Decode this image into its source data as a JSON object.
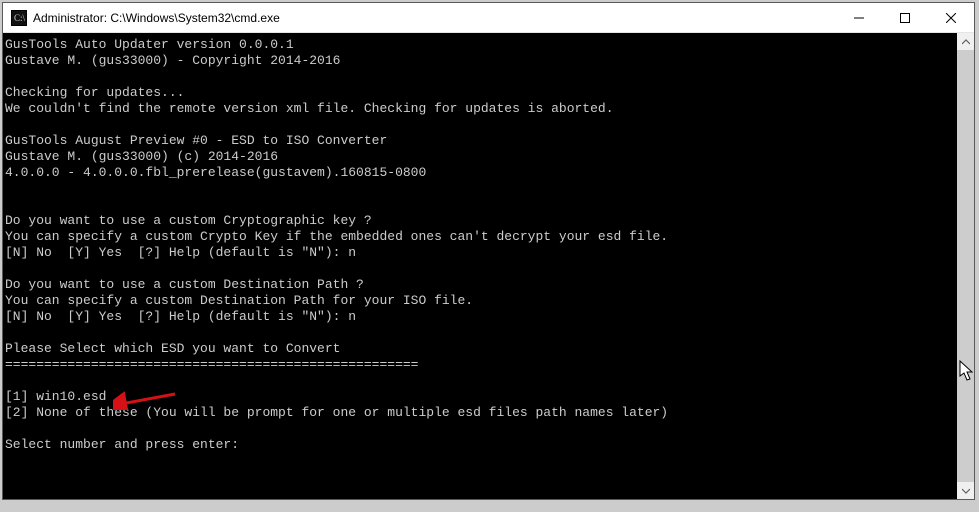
{
  "titlebar": {
    "title": "Administrator: C:\\Windows\\System32\\cmd.exe"
  },
  "terminal": {
    "lines": [
      "GusTools Auto Updater version 0.0.0.1",
      "Gustave M. (gus33000) - Copyright 2014-2016",
      "",
      "Checking for updates...",
      "We couldn't find the remote version xml file. Checking for updates is aborted.",
      "",
      "GusTools August Preview #0 - ESD to ISO Converter",
      "Gustave M. (gus33000) (c) 2014-2016",
      "4.0.0.0 - 4.0.0.0.fbl_prerelease(gustavem).160815-0800",
      "",
      "",
      "Do you want to use a custom Cryptographic key ?",
      "You can specify a custom Crypto Key if the embedded ones can't decrypt your esd file.",
      "[N] No  [Y] Yes  [?] Help (default is \"N\"): n",
      "",
      "Do you want to use a custom Destination Path ?",
      "You can specify a custom Destination Path for your ISO file.",
      "[N] No  [Y] Yes  [?] Help (default is \"N\"): n",
      "",
      "Please Select which ESD you want to Convert",
      "=====================================================",
      "",
      "[1] win10.esd",
      "[2] None of these (You will be prompt for one or multiple esd files path names later)",
      "",
      "Select number and press enter:"
    ]
  }
}
